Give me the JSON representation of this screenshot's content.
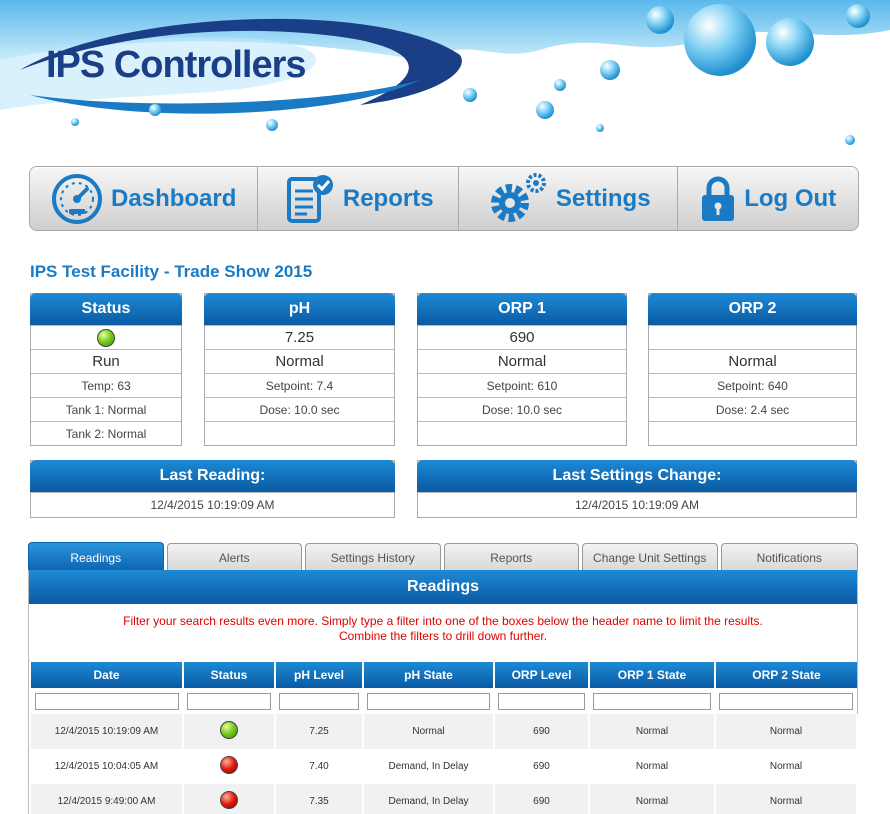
{
  "brand": {
    "name": "IPS Controllers"
  },
  "nav": [
    {
      "label": "Dashboard",
      "icon": "gauge-icon"
    },
    {
      "label": "Reports",
      "icon": "clipboard-check-icon"
    },
    {
      "label": "Settings",
      "icon": "gears-icon"
    },
    {
      "label": "Log Out",
      "icon": "lock-icon"
    }
  ],
  "facility": {
    "title": "IPS Test Facility - Trade Show 2015"
  },
  "cards": {
    "status": {
      "title": "Status",
      "state": "Run",
      "temp": "Temp: 63",
      "tank1": "Tank 1: Normal",
      "tank2": "Tank 2: Normal"
    },
    "ph": {
      "title": "pH",
      "value": "7.25",
      "state": "Normal",
      "setpoint": "Setpoint: 7.4",
      "dose": "Dose: 10.0 sec"
    },
    "orp1": {
      "title": "ORP 1",
      "value": "690",
      "state": "Normal",
      "setpoint": "Setpoint: 610",
      "dose": "Dose: 10.0 sec"
    },
    "orp2": {
      "title": "ORP 2",
      "value": "",
      "state": "Normal",
      "setpoint": "Setpoint: 640",
      "dose": "Dose: 2.4 sec"
    },
    "last_reading": {
      "title": "Last Reading:",
      "value": "12/4/2015 10:19:09 AM"
    },
    "last_settings": {
      "title": "Last Settings Change:",
      "value": "12/4/2015 10:19:09 AM"
    }
  },
  "tabs": [
    "Readings",
    "Alerts",
    "Settings History",
    "Reports",
    "Change Unit Settings",
    "Notifications"
  ],
  "readings": {
    "title": "Readings",
    "note_line1": "Filter your search results even more. Simply type a filter into one of the boxes below the header name to limit the results.",
    "note_line2": "Combine the filters to drill down further.",
    "columns": [
      "Date",
      "Status",
      "pH Level",
      "pH State",
      "ORP Level",
      "ORP 1 State",
      "ORP 2 State"
    ],
    "rows": [
      {
        "date": "12/4/2015 10:19:09 AM",
        "status": "green",
        "ph_level": "7.25",
        "ph_state": "Normal",
        "orp_level": "690",
        "orp1_state": "Normal",
        "orp2_state": "Normal"
      },
      {
        "date": "12/4/2015 10:04:05 AM",
        "status": "red",
        "ph_level": "7.40",
        "ph_state": "Demand, In Delay",
        "orp_level": "690",
        "orp1_state": "Normal",
        "orp2_state": "Normal"
      },
      {
        "date": "12/4/2015 9:49:00 AM",
        "status": "red",
        "ph_level": "7.35",
        "ph_state": "Demand, In Delay",
        "orp_level": "690",
        "orp1_state": "Normal",
        "orp2_state": "Normal"
      }
    ]
  },
  "colors": {
    "accent": "#1a7bc4",
    "header_blue": "#0a5aa3",
    "alert_red": "#e00000",
    "brand_navy": "#1b3f86"
  }
}
